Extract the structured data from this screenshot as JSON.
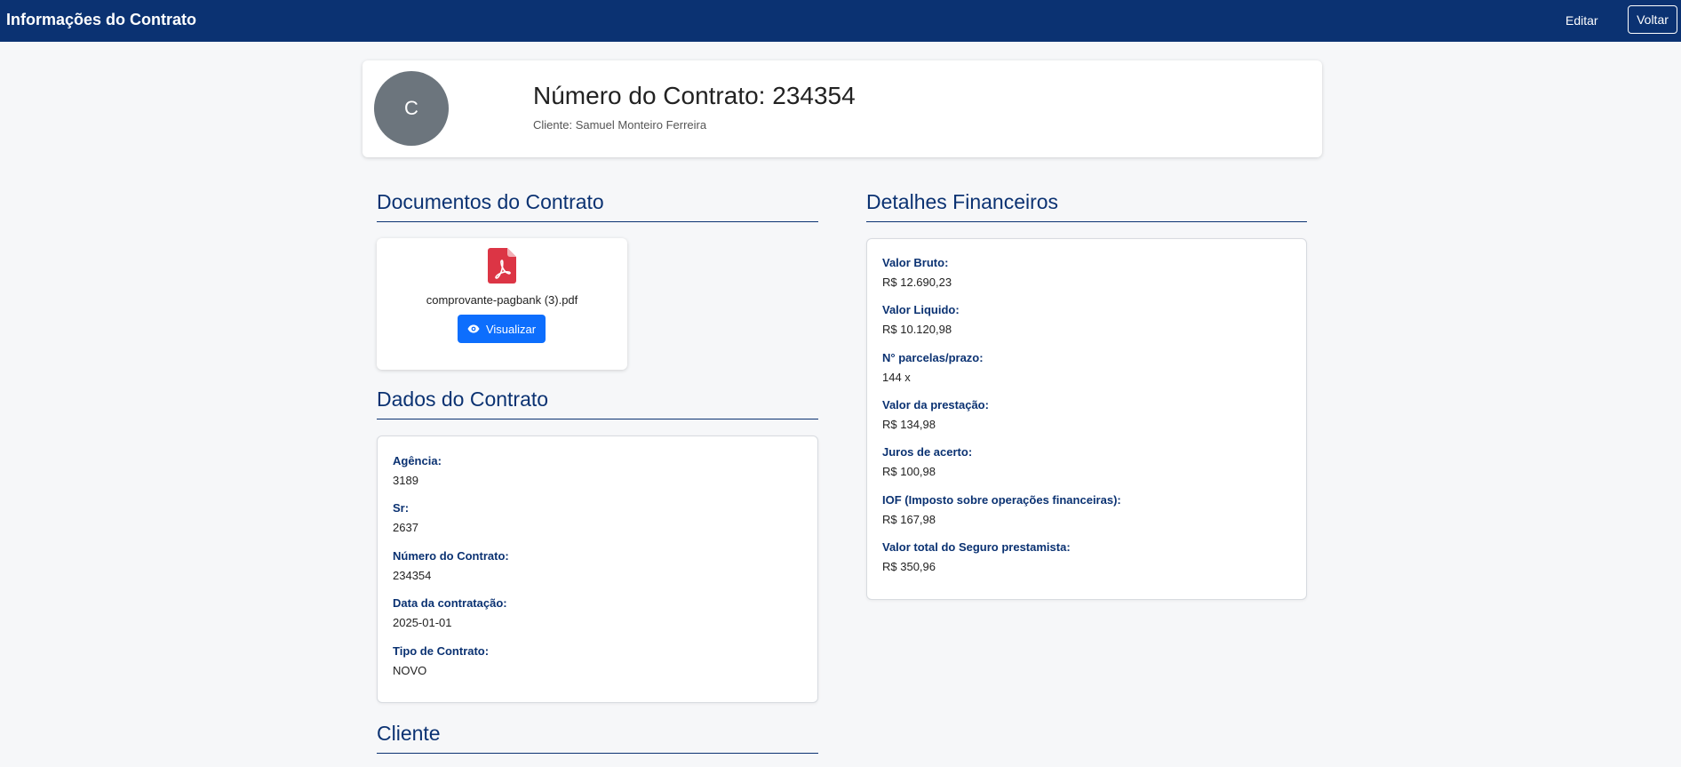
{
  "navbar": {
    "title": "Informações do Contrato",
    "edit_label": "Editar",
    "back_label": "Voltar"
  },
  "header": {
    "avatar_initial": "C",
    "title": "Número do Contrato: 234354",
    "client": "Cliente: Samuel Monteiro Ferreira"
  },
  "documents": {
    "title": "Documentos do Contrato",
    "items": [
      {
        "icon": "pdf-icon",
        "filename": "comprovante-pagbank (3).pdf",
        "view_label": "Visualizar",
        "view_icon": "eye-icon"
      }
    ]
  },
  "contract_data": {
    "title": "Dados do Contrato",
    "fields": [
      {
        "label": "Agência:",
        "value": "3189"
      },
      {
        "label": "Sr:",
        "value": "2637"
      },
      {
        "label": "Número do Contrato:",
        "value": "234354"
      },
      {
        "label": "Data da contratação:",
        "value": "2025-01-01"
      },
      {
        "label": "Tipo de Contrato:",
        "value": "NOVO"
      }
    ]
  },
  "financial": {
    "title": "Detalhes Financeiros",
    "fields": [
      {
        "label": "Valor Bruto:",
        "value": "R$ 12.690,23"
      },
      {
        "label": "Valor Liquido:",
        "value": "R$ 10.120,98"
      },
      {
        "label": "N° parcelas/prazo:",
        "value": "144 x"
      },
      {
        "label": "Valor da prestação:",
        "value": "R$ 134,98"
      },
      {
        "label": "Juros de acerto:",
        "value": "R$ 100,98"
      },
      {
        "label": "IOF (Imposto sobre operações financeiras):",
        "value": "R$ 167,98"
      },
      {
        "label": "Valor total do Seguro prestamista:",
        "value": "R$ 350,96"
      }
    ]
  },
  "client_section": {
    "title": "Cliente"
  },
  "colors": {
    "navbar": "#0b3272",
    "accent_button": "#0d6efd",
    "pdf_icon": "#dc3545",
    "avatar": "#6c757d"
  }
}
